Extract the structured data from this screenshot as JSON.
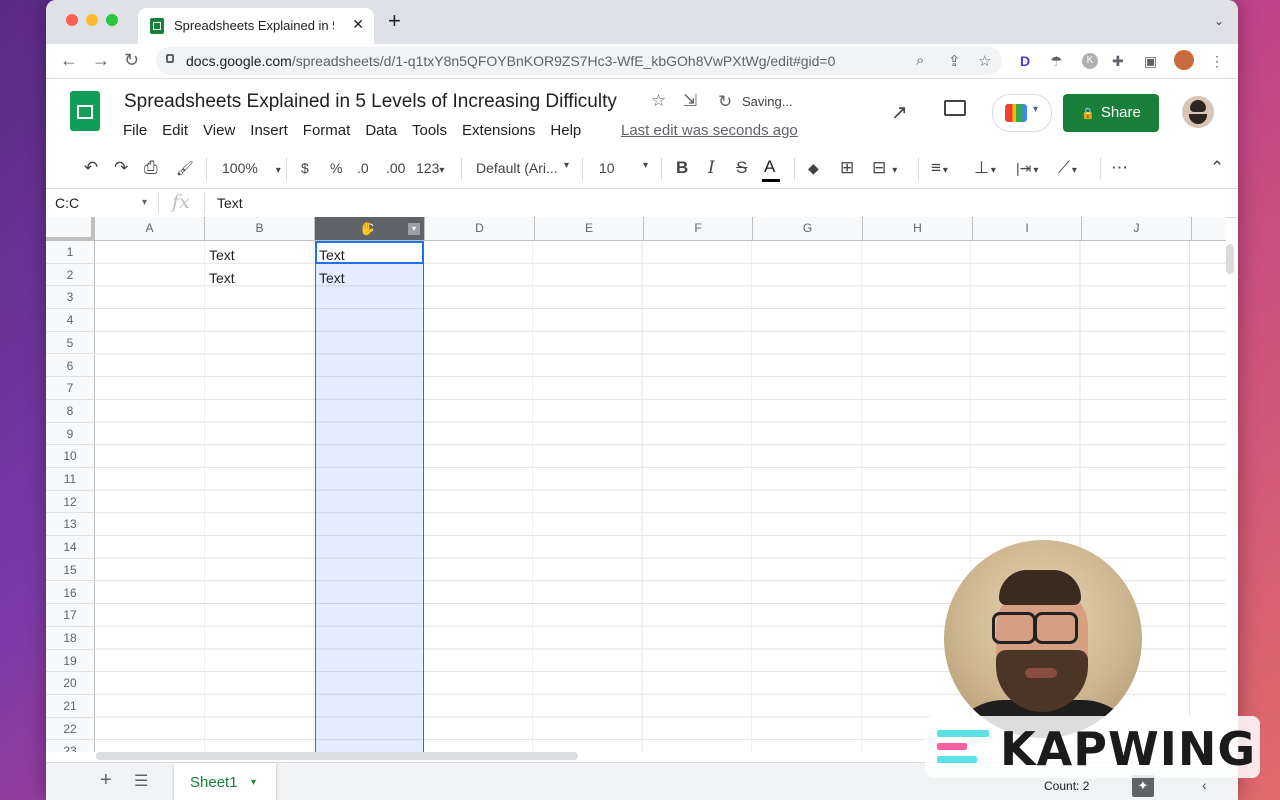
{
  "browser": {
    "tab_title": "Spreadsheets Explained in 5 Le",
    "tab_close": "✕",
    "new_tab": "+",
    "tab_list": "⌄",
    "nav": {
      "back": "←",
      "forward": "→",
      "reload": "↻"
    },
    "url_host": "docs.google.com",
    "url_path": "/spreadsheets/d/1-q1txY8n5QFOYBnKOR9ZS7Hc3-WfE_kbGOh8VwPXtWg/edit#gid=0",
    "omni_icons": {
      "zoom": "⌕",
      "share": "⇪",
      "bookmark": "☆"
    },
    "extensions": {
      "d": "D",
      "k": "K",
      "puzzle": "✚",
      "sidebar": "▣",
      "menu": "⋮"
    }
  },
  "doc": {
    "title": "Spreadsheets Explained in 5 Levels of Increasing Difficulty",
    "star_icon": "☆",
    "move_icon": "⇲",
    "saving_icon": "↻",
    "saving": "Saving...",
    "menu": [
      "File",
      "Edit",
      "View",
      "Insert",
      "Format",
      "Data",
      "Tools",
      "Extensions",
      "Help"
    ],
    "last_edit": "Last edit was seconds ago",
    "trend_icon": "↗",
    "meet_dd": "▾",
    "share_label": "Share",
    "share_icon": "🔒"
  },
  "format_toolbar": {
    "undo": "↶",
    "redo": "↷",
    "print": "⎙",
    "paint": "🖌",
    "zoom": "100%",
    "zoom_dd": "▾",
    "currency": "$",
    "percent": "%",
    "dec_less": ".0",
    "dec_more": ".00",
    "more_formats": "123",
    "font": "Default (Ari...",
    "font_size": "10",
    "bold": "B",
    "italic": "I",
    "strike": "S",
    "text_color": "A",
    "fill": "◆",
    "borders": "⊞",
    "merge": "⊟",
    "halign": "≡",
    "valign": "⊥",
    "wrap": "|⇥",
    "rotate": "⟋",
    "more": "⋯",
    "collapse": "⌃"
  },
  "formula_bar": {
    "name_box": "C:C",
    "name_dd": "▾",
    "fx": "fx",
    "value": "Text"
  },
  "grid": {
    "columns": [
      "A",
      "B",
      "C",
      "D",
      "E",
      "F",
      "G",
      "H",
      "I",
      "J"
    ],
    "selected_column": "C",
    "rows": [
      "1",
      "2",
      "3",
      "4",
      "5",
      "6",
      "7",
      "8",
      "9",
      "10",
      "11",
      "12",
      "13",
      "14",
      "15",
      "16",
      "17",
      "18",
      "19",
      "20",
      "21",
      "22",
      "23"
    ],
    "cells": {
      "B1": "Text",
      "B2": "Text",
      "C1": "Text",
      "C2": "Text"
    }
  },
  "bottom": {
    "add": "+",
    "all_sheets": "☰",
    "sheet_tab": "Sheet1",
    "sheet_dd": "▾",
    "count": "Count: 2",
    "explore": "✦",
    "collapse": "‹"
  },
  "watermark": {
    "text": "KAPWING",
    "colors": [
      "#5ce1e6",
      "#ff5fa2",
      "#ffb84d"
    ]
  }
}
